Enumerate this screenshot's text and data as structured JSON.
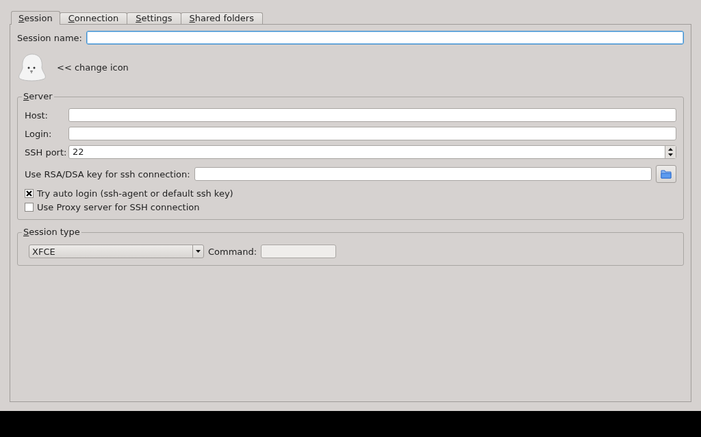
{
  "tabs": [
    {
      "label": "Session",
      "selected": true
    },
    {
      "label": "Connection",
      "selected": false
    },
    {
      "label": "Settings",
      "selected": false
    },
    {
      "label": "Shared folders",
      "selected": false
    }
  ],
  "session_name": {
    "label": "Session name:",
    "focused": true
  },
  "change_icon": {
    "label": "<< change icon"
  },
  "server": {
    "title": "Server",
    "fields": [
      {
        "label": "Host:",
        "kind": "text"
      },
      {
        "label": "Login:",
        "kind": "text"
      },
      {
        "label": "SSH port:",
        "value": "22",
        "kind": "spin"
      }
    ],
    "key": {
      "label": "Use RSA/DSA key for ssh connection:"
    },
    "checkboxes": [
      {
        "label": "Try auto login (ssh-agent or default ssh key)",
        "checked": true
      },
      {
        "label": "Use Proxy server for SSH connection",
        "checked": false
      }
    ]
  },
  "session_type": {
    "title": "Session type",
    "selected_type": "XFCE",
    "command": {
      "label": "Command:",
      "disabled": true
    }
  }
}
